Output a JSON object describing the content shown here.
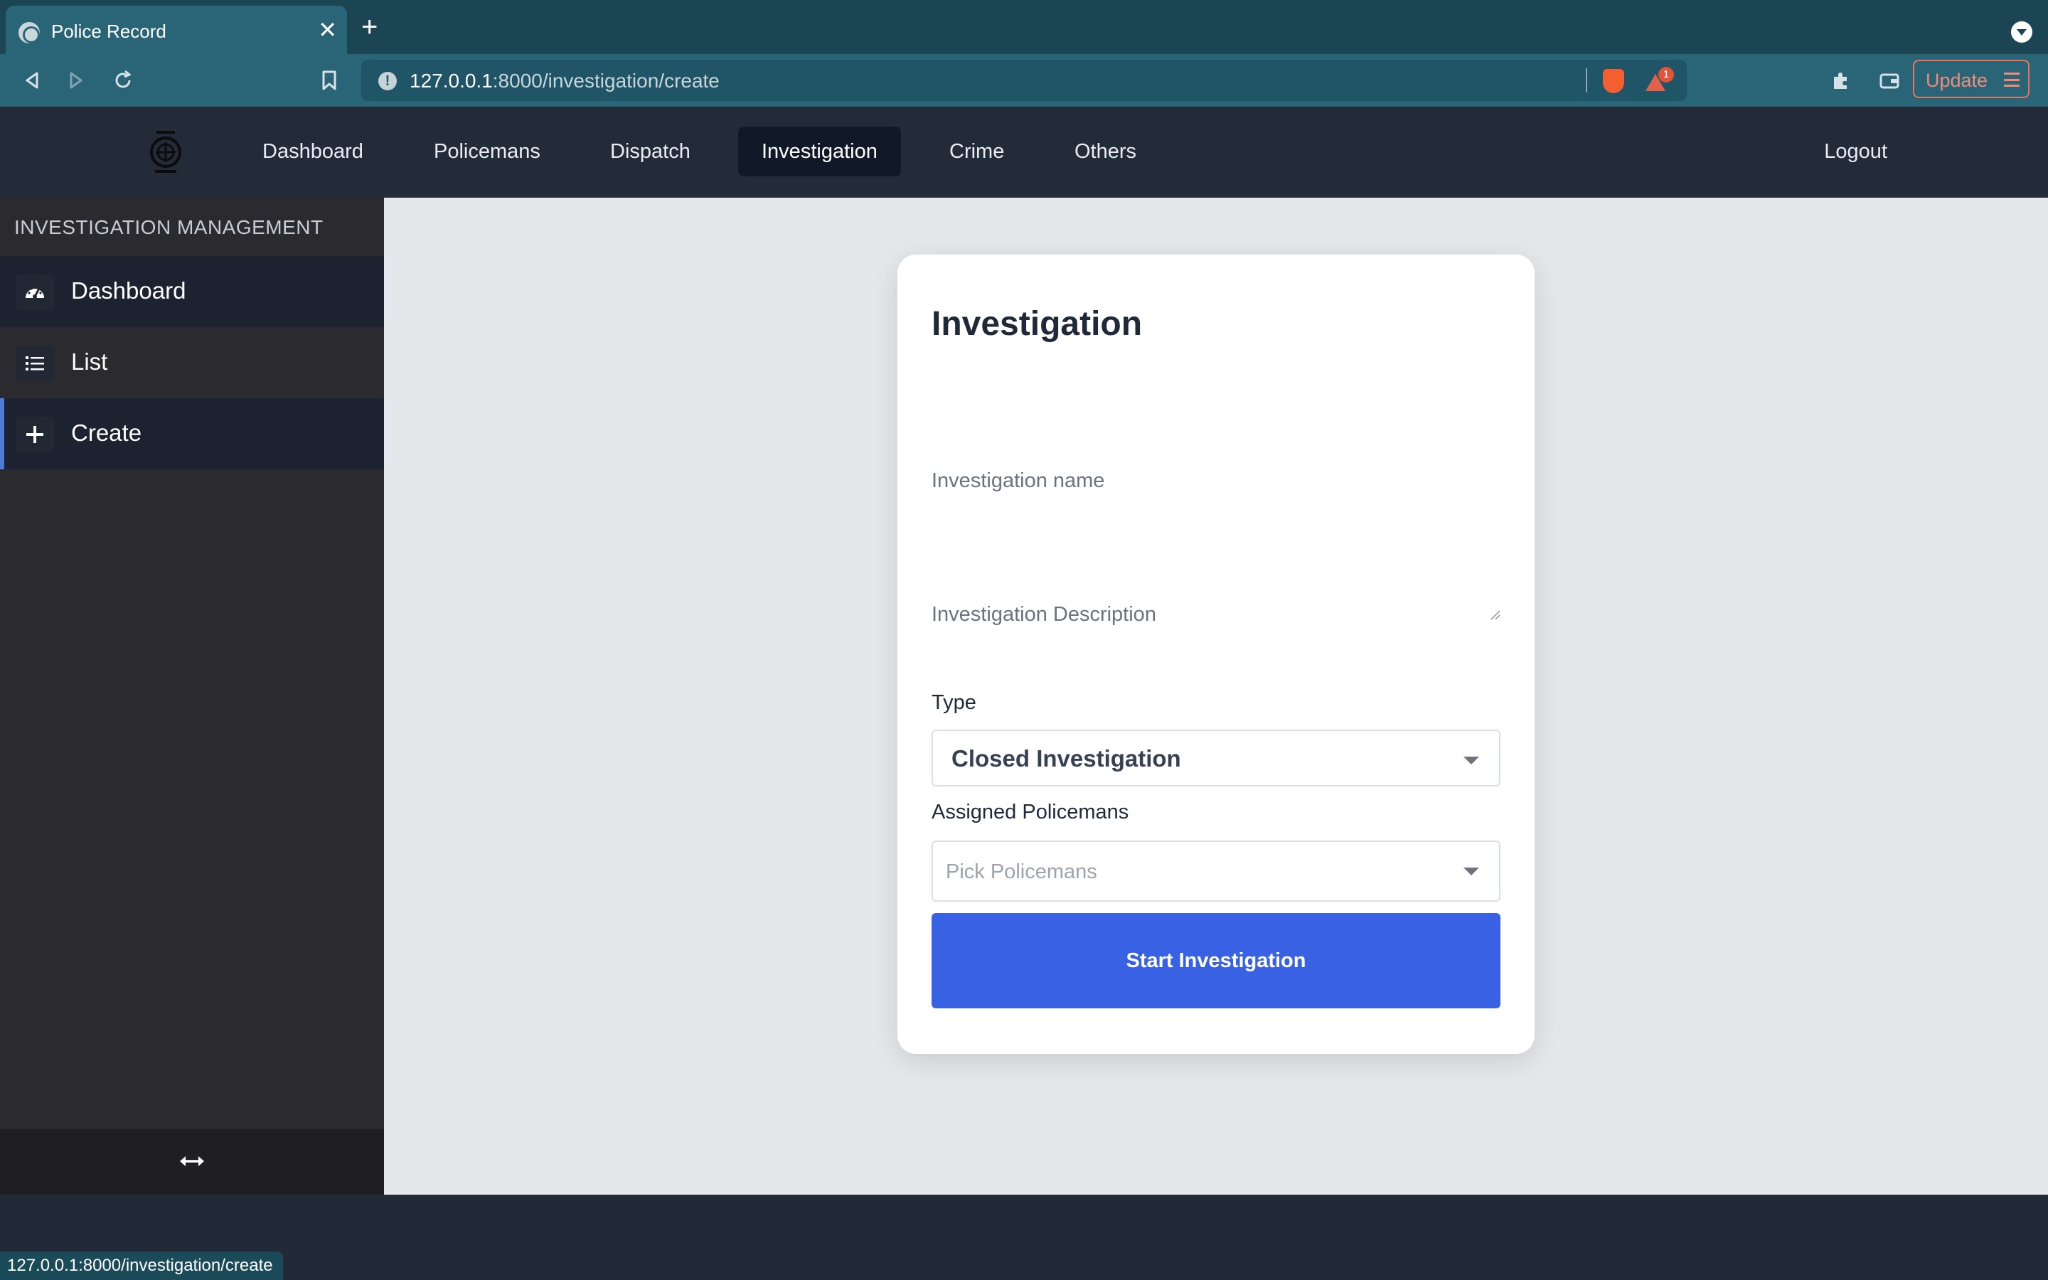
{
  "browser": {
    "tab_title": "Police Record",
    "url_host": "127.0.0.1",
    "url_path": ":8000/investigation/create",
    "update_label": "Update",
    "rewards_badge": "1",
    "status_url": "127.0.0.1:8000/investigation/create"
  },
  "nav": {
    "items": [
      "Dashboard",
      "Policemans",
      "Dispatch",
      "Investigation",
      "Crime",
      "Others"
    ],
    "active": "Investigation",
    "logout": "Logout"
  },
  "sidebar": {
    "heading": "INVESTIGATION MANAGEMENT",
    "items": [
      {
        "label": "Dashboard",
        "icon": "gauge-icon"
      },
      {
        "label": "List",
        "icon": "list-icon"
      },
      {
        "label": "Create",
        "icon": "plus-icon"
      }
    ],
    "selected": "Create"
  },
  "form": {
    "title": "Investigation",
    "name_label": "Investigation name",
    "name_value": "",
    "description_label": "Investigation Description",
    "description_value": "",
    "type_label": "Type",
    "type_value": "Closed Investigation",
    "policemen_label": "Assigned Policemans",
    "policemen_placeholder": "Pick Policemans",
    "submit_label": "Start Investigation"
  },
  "colors": {
    "primary_button": "#3961e3",
    "active_nav": "#111827",
    "browser_chrome": "#2a6577",
    "selected_accent": "#4f7bd6"
  }
}
